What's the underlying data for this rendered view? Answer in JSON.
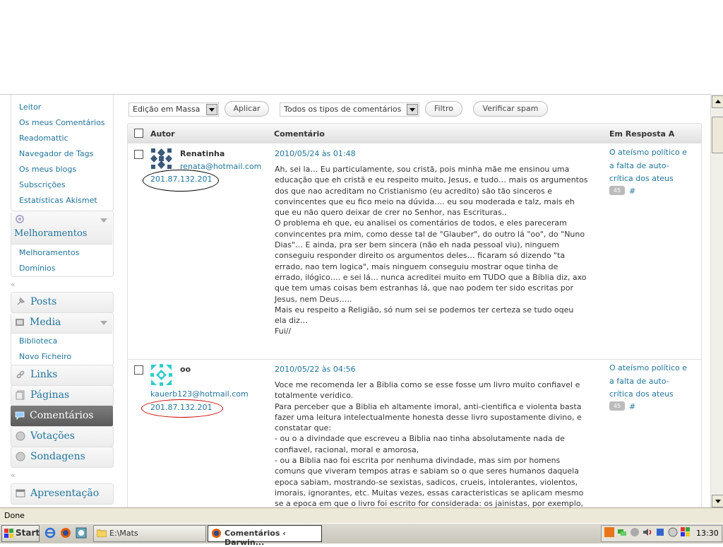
{
  "sidebar": {
    "users_items": [
      "Leitor",
      "Os meus Comentários",
      "Readomattic",
      "Navegador de Tags",
      "Os meus blogs",
      "Subscrições",
      "Estatísticas Akismet"
    ],
    "melhoramentos": {
      "label": "Melhoramentos",
      "items": [
        "Melhoramentos",
        "Domínios"
      ]
    },
    "posts": "Posts",
    "media": {
      "label": "Media",
      "items": [
        "Biblioteca",
        "Novo Ficheiro"
      ]
    },
    "links": "Links",
    "paginas": "Páginas",
    "comentarios": "Comentários",
    "votacoes": "Votações",
    "sondagens": "Sondagens",
    "apresentacao": "Apresentação",
    "collapse_glyph": "«"
  },
  "toolbar": {
    "bulk_select": "Edição em Massa",
    "apply_button": "Aplicar",
    "type_select": "Todos os tipos de comentários",
    "filter_button": "Filtro",
    "spam_button": "Verificar spam"
  },
  "table": {
    "headers": {
      "author": "Autor",
      "comment": "Comentário",
      "response": "Em Resposta A"
    },
    "rows": [
      {
        "author": "Renatinha",
        "email": "renata@hotmail.com",
        "ip": "201.87.132.201",
        "date": "2010/05/24 às 01:48",
        "text": "Ah, sei la… Eu particulamente, sou cristã, pois minha mãe me ensinou uma\neducação que eh cristã e eu respeito muito, Jesus, e tudo… mais os argumentos\ndos que nao acreditam no Cristianismo (eu acredito) são tão sinceros e\nconvincentes que eu fico meio na dúvida…. eu sou moderada e talz, mais eh\nque eu não quero deixar de crer no Senhor, nas Escrituras..\nO problema eh que, eu analisei os comentários de todos, e eles pareceram\nconvincentes pra mim, como desse tal de \"Glauber\", do outro lá \"oo\", do \"Nuno\nDias\"… E ainda, pra ser bem sincera (não eh nada pessoal viu), ninguem\nconseguiu responder direito os argumentos deles… ficaram só dizendo \"ta\nerrado, nao tem logica\", mais ninguem conseguiu mostrar oque tinha de\nerrado, ilógico…. e sei lá… nunca acreditei muito em TUDO que a Bíblia diz, axo\nque tem umas coisas bem estranhas lá, que nao podem ter sido escritas por\nJesus, nem Deus…..\nMais eu respeito a Religião, só num sei se podemos ter certeza se tudo oqeu\nela diz…\nFui//",
        "response": "O ateísmo político e a falta de auto-crítica dos ateus",
        "count": "45",
        "hash": "#"
      },
      {
        "author": "oo",
        "email": "kauerb123@hotmail.com",
        "ip": "201.87.132.201",
        "date": "2010/05/22 às 04:56",
        "text": "Voce me recomenda ler a Biblia como se esse fosse um livro muito confiavel e\ntotalmente veridico.\nPara perceber que a Biblia eh altamente imoral, anti-cientifica e violenta basta\nfazer uma leitura intelectualmente honesta desse livro supostamente divino, e\nconstatar que:\n- ou o a divindade que escreveu a Biblia nao tinha absolutamente nada de\nconfiavel, racional, moral e amorosa,\n- ou a Biblia nao foi escrita por nenhuma divindade, mas sim por homens\ncomuns que viveram tempos atras e sabiam so o que seres humanos daquela\nepoca sabiam, mostrando-se sexistas, sadicos, crueis, intolerantes, violentos,\nimorais, ignorantes, etc. Muitas vezes, essas caracteristicas se aplicam mesmo\nse a epoca em que o livro foi escrito for considerada: os jainistas, por exemplo,",
        "response": "O ateísmo político e a falta de auto-crítica dos ateus",
        "count": "45",
        "hash": "#"
      }
    ]
  },
  "statusbar": {
    "text": "Done"
  },
  "taskbar": {
    "start": "Start",
    "tasks": [
      "E:\\Mats",
      "Comentários ‹ Darwin..."
    ],
    "clock": "13:30"
  }
}
